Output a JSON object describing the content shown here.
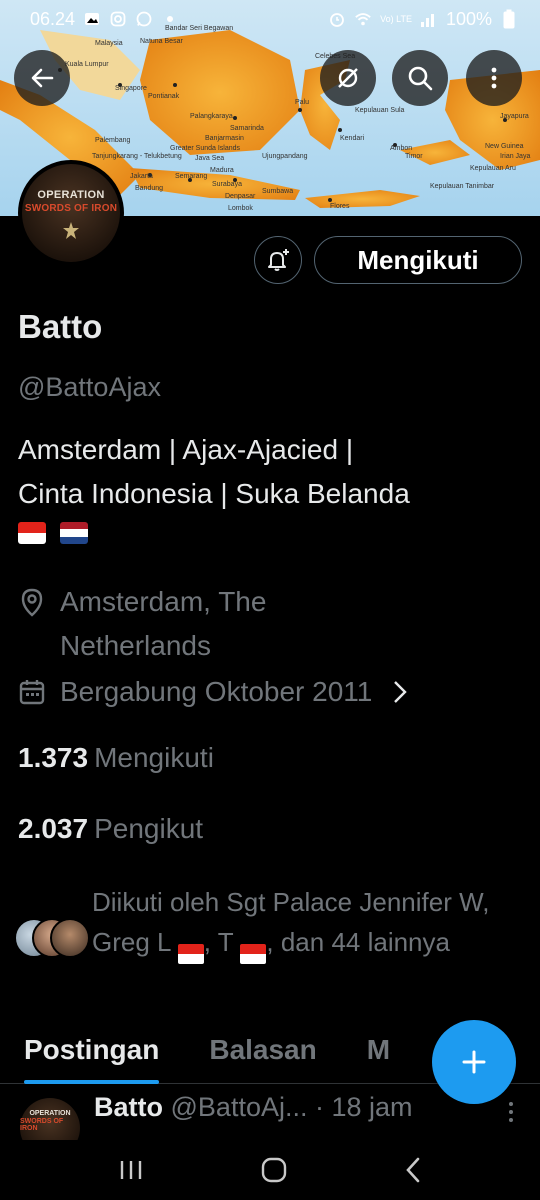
{
  "status_bar": {
    "time": "06.24",
    "battery": "100%",
    "network": "Vo) LTE"
  },
  "banner": {
    "description_icons": [
      "back-arrow-icon",
      "translate-icon",
      "search-icon",
      "more-vertical-icon"
    ],
    "map_labels": [
      {
        "text": "Malaysia"
      },
      {
        "text": "Kuala Lumpur"
      },
      {
        "text": "Singapore"
      },
      {
        "text": "Pontianak"
      },
      {
        "text": "Samarinda"
      },
      {
        "text": "Palu"
      },
      {
        "text": "Celebes Sea"
      },
      {
        "text": "Jakarta"
      },
      {
        "text": "Bandung"
      },
      {
        "text": "Semarang"
      },
      {
        "text": "Surabaya"
      },
      {
        "text": "Java Sea"
      },
      {
        "text": "Flores"
      },
      {
        "text": "Timor"
      },
      {
        "text": "Ambon"
      },
      {
        "text": "New Guinea"
      },
      {
        "text": "Irian Jaya"
      },
      {
        "text": "Jayapura"
      },
      {
        "text": "Sumbawa"
      },
      {
        "text": "Lombok"
      },
      {
        "text": "Palangkaraya"
      },
      {
        "text": "Banjarmasin"
      },
      {
        "text": "Ujungpandang"
      },
      {
        "text": "Kendari"
      },
      {
        "text": "Kepulauan Tanimbar"
      },
      {
        "text": "Kepulauan Aru"
      },
      {
        "text": "Kepulauan Sula"
      },
      {
        "text": "Greater Sunda Islands"
      },
      {
        "text": "Tanjungkarang - Telukbetung"
      },
      {
        "text": "Natuna Besar"
      },
      {
        "text": "Bandar Seri Begawan"
      },
      {
        "text": "Palembang"
      },
      {
        "text": "Denpasar"
      },
      {
        "text": "Madura"
      }
    ],
    "avatar_text": {
      "line1": "OPERATION",
      "line2": "SWORDS OF IRON"
    }
  },
  "actions": {
    "follow_label": "Mengikuti"
  },
  "profile": {
    "name": "Batto",
    "handle": "@BattoAjax",
    "bio_line1": "Amsterdam | Ajax-Ajacied |",
    "bio_line2": "Cinta Indonesia | Suka Belanda",
    "flags": [
      "indonesia-flag",
      "netherlands-flag"
    ],
    "location": "Amsterdam, The Netherlands",
    "joined": "Bergabung Oktober 2011"
  },
  "stats": {
    "following_count": "1.373",
    "following_label": "Mengikuti",
    "followers_count": "2.037",
    "followers_label": "Pengikut"
  },
  "followed_by": {
    "part1": "Diikuti oleh Sgt Palace Jennifer W, Greg L",
    "part2": ", T",
    "part3": ", dan 44 lainnya"
  },
  "tabs": {
    "posts": "Postingan",
    "replies": "Balasan",
    "media_partial": "M"
  },
  "post": {
    "name": "Batto",
    "handle": "@BattoAj...",
    "time": "· 18 jam"
  },
  "colors": {
    "accent": "#1d9bf0",
    "text_primary": "#e7e9ea",
    "text_secondary": "#71767b",
    "border": "#536471",
    "background": "#000000"
  }
}
